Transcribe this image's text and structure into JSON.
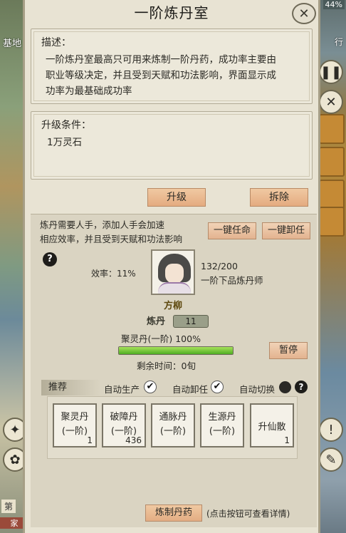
{
  "background": {
    "left_label": "基地",
    "right_label": "行",
    "bottom_left_label": "第",
    "bottom_left_tab": "家",
    "right_pct": "44%"
  },
  "panel": {
    "title": "一阶炼丹室",
    "close_icon": "close-icon"
  },
  "description": {
    "heading": "描述：",
    "lines": [
      "一阶炼丹室最高只可用来炼制一阶丹药，成功率主要由",
      "职业等级决定，并且受到天赋和功法影响，界面显示成",
      "功率为最基础成功率"
    ]
  },
  "upgrade": {
    "heading": "升级条件：",
    "requirement": "1万灵石"
  },
  "actions": {
    "upgrade_label": "升级",
    "demolish_label": "拆除"
  },
  "staff": {
    "info_line1": "炼丹需要人手，添加人手会加速",
    "info_line2": "相应效率，并且受到天赋和功法影响",
    "help": "?",
    "assign_label": "一键任命",
    "dismiss_label": "一键卸任",
    "efficiency": "效率：11%",
    "exp": "132/200",
    "rank": "一阶下品炼丹师",
    "name": "方柳",
    "skill_label": "炼丹",
    "skill_value": "11"
  },
  "production": {
    "current": "聚灵丹(一阶) 100%",
    "progress": 1.0,
    "pause_label": "暂停",
    "remaining": "剩余时间：0旬"
  },
  "toggles": {
    "tab_label": "推荐",
    "auto_produce": "自动生产",
    "auto_dismiss": "自动卸任",
    "auto_switch": "自动切换",
    "help": "?"
  },
  "recipes": [
    {
      "line1": "聚灵丹",
      "line2": "(一阶)",
      "count": "1"
    },
    {
      "line1": "破障丹",
      "line2": "(一阶)",
      "count": "436"
    },
    {
      "line1": "通脉丹",
      "line2": "(一阶)",
      "count": ""
    },
    {
      "line1": "生源丹",
      "line2": "(一阶)",
      "count": ""
    },
    {
      "line1": "升仙散",
      "line2": "",
      "count": "1"
    }
  ],
  "footer": {
    "craft_label": "炼制丹药",
    "hint": "(点击按钮可查看详情)"
  }
}
